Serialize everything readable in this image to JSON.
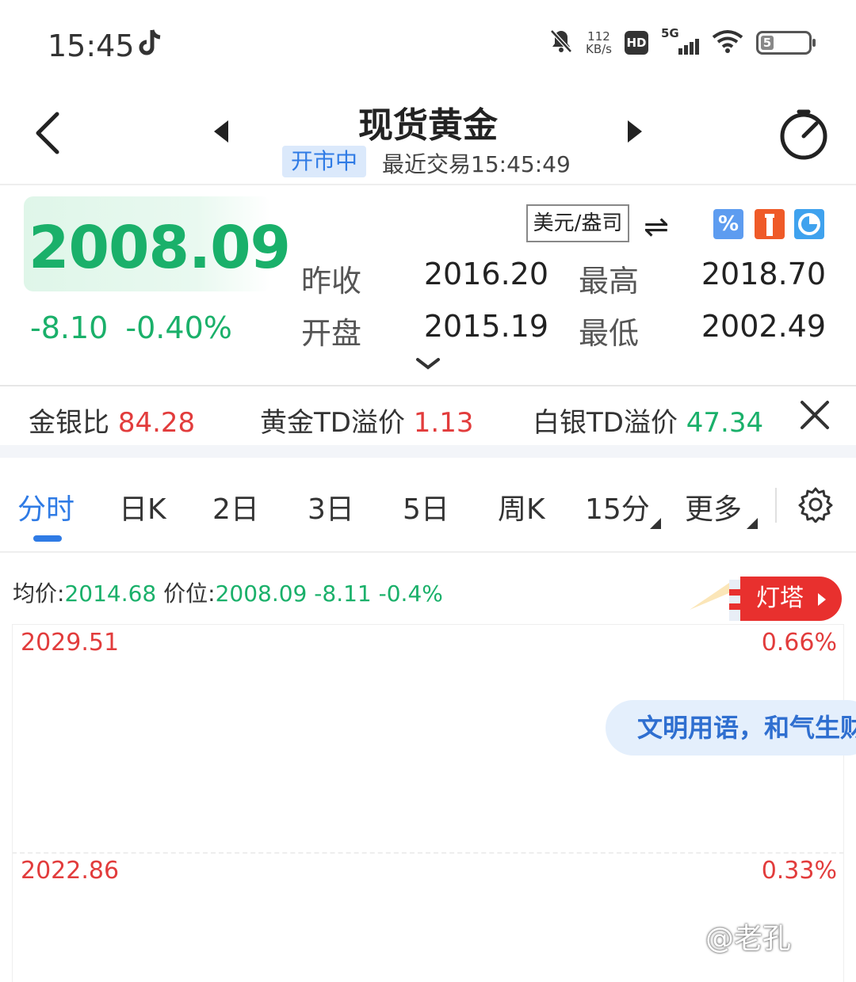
{
  "status_bar": {
    "time": "15:45",
    "net_speed_value": "112",
    "net_speed_unit": "KB/s",
    "hd": "HD",
    "network": "5G",
    "battery": "5",
    "icons": [
      "tiktok-icon",
      "mute-bell-icon",
      "signal-icon",
      "wifi-icon",
      "battery-icon"
    ]
  },
  "header": {
    "title": "现货黄金",
    "market_status": "开市中",
    "last_trade": "最近交易15:45:49"
  },
  "quote": {
    "price": "2008.09",
    "change": "-8.10",
    "change_pct": "-0.40%",
    "unit": "美元/盎司",
    "swap_glyph": "⇌",
    "percent_glyph": "%",
    "prev_close_label": "昨收",
    "prev_close": "2016.20",
    "high_label": "最高",
    "high": "2018.70",
    "open_label": "开盘",
    "open": "2015.19",
    "low_label": "最低",
    "low": "2002.49"
  },
  "ratios": {
    "gold_silver_label": "金银比",
    "gold_silver_value": "84.28",
    "gold_td_label": "黄金TD溢价",
    "gold_td_value": "1.13",
    "silver_td_label": "白银TD溢价",
    "silver_td_value": "47.34"
  },
  "tabs": [
    {
      "label": "分时",
      "active": true
    },
    {
      "label": "日K"
    },
    {
      "label": "2日"
    },
    {
      "label": "3日"
    },
    {
      "label": "5日"
    },
    {
      "label": "周K"
    },
    {
      "label": "15分"
    },
    {
      "label": "更多"
    }
  ],
  "chart": {
    "avg_label": "均价:",
    "avg_value": "2014.68",
    "pos_label": "价位:",
    "pos_value": "2008.09",
    "pos_change": "-8.11",
    "pos_pct": "-0.4%",
    "lighthouse_label": "灯塔",
    "top_price": "2029.51",
    "top_pct": "0.66%",
    "mid_price": "2022.86",
    "mid_pct": "0.33%"
  },
  "toast": "文明用语，和气生财",
  "watermark": "@老孔",
  "colors": {
    "up": "#e23c3c",
    "down": "#1ab06a",
    "accent": "#2f7be5"
  }
}
